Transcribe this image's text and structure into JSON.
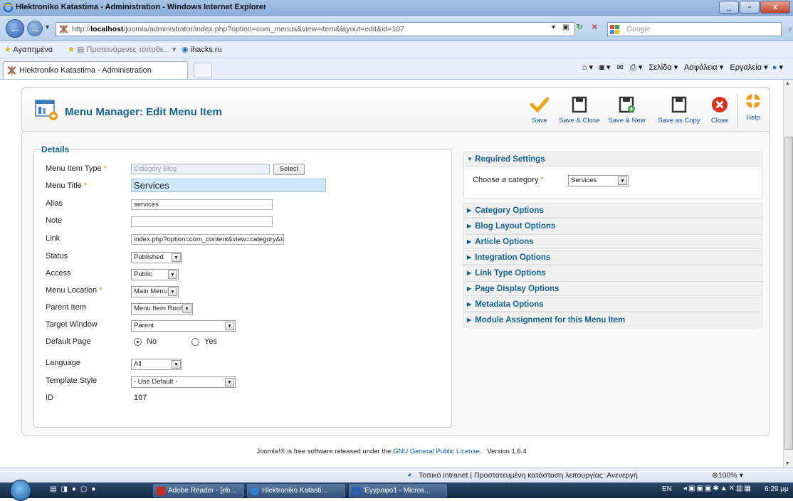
{
  "window": {
    "title": "Hlektroniko Katastima - Administration - Windows Internet Explorer",
    "controls": [
      "_",
      "▫",
      "x"
    ]
  },
  "address_bar": {
    "url_prefix": "http://",
    "url_host": "localhost",
    "url_rest": "/joomla/administrator/index.php?option=com_menus&view=item&layout=edit&id=107",
    "search_placeholder": "Google"
  },
  "favorites_bar": {
    "favorites_label": "Αγαπημένα",
    "suggested_label": "Προτεινόμενες τοποθε...",
    "site_label": "ihacks.ru"
  },
  "tab": {
    "label": "Hlektroniko Katastima - Administration"
  },
  "command_bar": {
    "page_label": "Σελίδα",
    "safety_label": "Ασφάλεια",
    "tools_label": "Εργαλεία"
  },
  "header": {
    "title": "Menu Manager: Edit Menu Item"
  },
  "toolbar": {
    "save": "Save",
    "save_close": "Save & Close",
    "save_new": "Save & New",
    "save_copy": "Save as Copy",
    "close": "Close",
    "help": "Help"
  },
  "details": {
    "legend": "Details",
    "menu_item_type_label": "Menu Item Type",
    "menu_item_type_value": "Category Blog",
    "select_button": "Select",
    "menu_title_label": "Menu Title",
    "menu_title_value": "Services",
    "alias_label": "Alias",
    "alias_value": "services",
    "note_label": "Note",
    "note_value": "",
    "link_label": "Link",
    "link_value": "index.php?option=com_content&view=category&layout=b",
    "status_label": "Status",
    "status_value": "Published",
    "access_label": "Access",
    "access_value": "Public",
    "menu_location_label": "Menu Location",
    "menu_location_value": "Main Menu",
    "parent_item_label": "Parent Item",
    "parent_item_value": "Menu Item Root",
    "target_window_label": "Target Window",
    "target_window_value": "Parent",
    "default_page_label": "Default Page",
    "default_page_no": "No",
    "default_page_yes": "Yes",
    "language_label": "Language",
    "language_value": "All",
    "template_style_label": "Template Style",
    "template_style_value": "- Use Default -",
    "id_label": "ID",
    "id_value": "107",
    "required_mark": "*"
  },
  "panes": {
    "required_title": "Required Settings",
    "choose_category_label": "Choose a category",
    "choose_category_value": "Services",
    "collapsed": [
      "Category Options",
      "Blog Layout Options",
      "Article Options",
      "Integration Options",
      "Link Type Options",
      "Page Display Options",
      "Metadata Options",
      "Module Assignment for this Menu Item"
    ]
  },
  "footer": {
    "prefix": "Joomla!® is free software released under the",
    "license": "GNU General Public License.",
    "version": "Version 1.6.4"
  },
  "status_bar": {
    "zone": "Τοπικό intranet | Προστατευμένη κατάσταση λειτουργίας: Ανενεργή",
    "zoom": "100%"
  },
  "taskbar": {
    "tasks": [
      "Adobe Reader - [eb...",
      "Hlektroniko Katasti...",
      "Έγγραφο1 - Micros..."
    ],
    "lang": "EN",
    "clock": "6:29 μμ"
  },
  "colors": {
    "joomla_blue": "#146295",
    "link_blue": "#0b55c4",
    "required_orange": "#ff7f00",
    "title_input_bg": "#cfe7fa"
  }
}
